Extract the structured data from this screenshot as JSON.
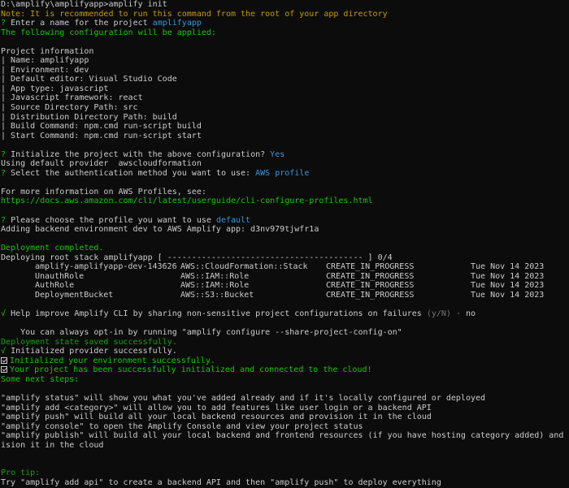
{
  "cwd_prompt": "D:\\amplify\\amplifyapp>amplify init",
  "note": "Note: It is recommended to run this command from the root of your app directory",
  "q_name": {
    "mark": "?",
    "text": "Enter a name for the project",
    "answer": "amplifyapp"
  },
  "config_applied": "The following configuration will be applied:",
  "project_info_title": "Project information",
  "project_info": [
    "| Name: amplifyapp",
    "| Environment: dev",
    "| Default editor: Visual Studio Code",
    "| App type: javascript",
    "| Javascript framework: react",
    "| Source Directory Path: src",
    "| Distribution Directory Path: build",
    "| Build Command: npm.cmd run-script build",
    "| Start Command: npm.cmd run-script start"
  ],
  "q_init": {
    "mark": "?",
    "text": "Initialize the project with the above configuration?",
    "answer": "Yes"
  },
  "default_provider": "Using default provider  awscloudformation",
  "q_auth": {
    "mark": "?",
    "text": "Select the authentication method you want to use:",
    "answer": "AWS profile"
  },
  "more_info": "For more information on AWS Profiles, see:",
  "profiles_url": "https://docs.aws.amazon.com/cli/latest/userguide/cli-configure-profiles.html",
  "q_profile": {
    "mark": "?",
    "text": "Please choose the profile you want to use",
    "answer": "default"
  },
  "adding_backend": "Adding backend environment dev to AWS Amplify app: d3nv979tjwfr1a",
  "deployment_completed": "Deployment completed.",
  "deploying_stack": "Deploying root stack amplifyapp [ ---------------------------------------- ] 0/4",
  "resources": [
    {
      "name": "amplify-amplifyapp-dev-143626",
      "type": "AWS::CloudFormation::Stack",
      "status": "CREATE_IN_PROGRESS",
      "time": "Tue Nov 14 2023"
    },
    {
      "name": "UnauthRole",
      "type": "AWS::IAM::Role",
      "status": "CREATE_IN_PROGRESS",
      "time": "Tue Nov 14 2023"
    },
    {
      "name": "AuthRole",
      "type": "AWS::IAM::Role",
      "status": "CREATE_IN_PROGRESS",
      "time": "Tue Nov 14 2023"
    },
    {
      "name": "DeploymentBucket",
      "type": "AWS::S3::Bucket",
      "status": "CREATE_IN_PROGRESS",
      "time": "Tue Nov 14 2023"
    }
  ],
  "q_improve": {
    "mark": "√",
    "text": "Help improve Amplify CLI by sharing non-sensitive project configurations on failures",
    "hint": "(y/N)",
    "dot": "·",
    "answer": "no"
  },
  "opt_in": "    You can always opt-in by running \"amplify configure --share-project-config-on\"",
  "state_saved": "Deployment state saved successfully.",
  "init_provider": {
    "mark": "√",
    "text": "Initialized provider successfully."
  },
  "init_env": "Initialized your environment successfully.",
  "init_project": "Your project has been successfully initialized and connected to the cloud!",
  "next_steps": "Some next steps:",
  "steps": [
    "\"amplify status\" will show you what you've added already and if it's locally configured or deployed",
    "\"amplify add <category>\" will allow you to add features like user login or a backend API",
    "\"amplify push\" will build all your local backend resources and provision it in the cloud",
    "\"amplify console\" to open the Amplify Console and view your project status",
    "\"amplify publish\" will build all your local backend and frontend resources (if you have hosting category added) and prov",
    "ision it in the cloud"
  ],
  "pro_tip": "Pro tip:",
  "tip_text": "Try \"amplify add api\" to create a backend API and then \"amplify push\" to deploy everything",
  "colors": {
    "background": "#0c0c0c",
    "text": "#cccccc",
    "yellow": "#c19c00",
    "green": "#13a10e",
    "blue": "#3b78ff",
    "gray": "#767676"
  }
}
